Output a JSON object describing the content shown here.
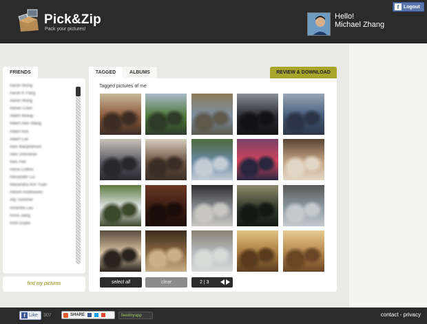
{
  "header": {
    "logo_title": "Pick&Zip",
    "logo_tagline": "Pack your pictures!",
    "greeting": "Hello!",
    "user_name": "Michael Zhang",
    "logout_label": "Logout"
  },
  "friends": {
    "tab_label": "FRIENDS",
    "items": [
      "Aaron Wong",
      "Aaron K Pang",
      "Aaron Wang",
      "Adrian Chen",
      "Albert Mckay",
      "Albert Alex Wang",
      "Albert Kim",
      "Albert Luk",
      "Alex Macpherson",
      "Alex Ostrowski",
      "Alex Pan",
      "Alexa Collins",
      "Alexander Liu",
      "Alexandra Ann Yuan",
      "Allison Andreasen",
      "Ally Sommer",
      "Amanda Lau",
      "Anna Jiang",
      "Amit Gupta"
    ],
    "find_label": "find my pictures"
  },
  "main": {
    "tabs": [
      {
        "label": "TAGGED",
        "active": true
      },
      {
        "label": "ALBUMS",
        "active": false
      }
    ],
    "review_label": "REVIEW & DOWNLOAD",
    "section_title": "Tagged pictures of me",
    "select_all_label": "select all",
    "clear_label": "clear",
    "pager_label": "2 | 3",
    "photos": [
      {
        "name": "photo-gym-group",
        "colors": [
          "#8a5a3a",
          "#c9b79a",
          "#3d2e25"
        ]
      },
      {
        "name": "photo-lawn-group",
        "colors": [
          "#4f7a3a",
          "#a8b9c8",
          "#2d3b28"
        ]
      },
      {
        "name": "photo-field-crowd",
        "colors": [
          "#7d8fa4",
          "#8c7b5a",
          "#5d5a4c"
        ]
      },
      {
        "name": "photo-silhouette-jump",
        "colors": [
          "#2a2a30",
          "#8a8e96",
          "#121214"
        ]
      },
      {
        "name": "photo-big-group",
        "colors": [
          "#445c7a",
          "#9aa6b5",
          "#2c3548"
        ]
      },
      {
        "name": "photo-indoor-group",
        "colors": [
          "#5c5c64",
          "#c8c2b8",
          "#28282c"
        ]
      },
      {
        "name": "photo-room-cake",
        "colors": [
          "#6b5340",
          "#d8cfc0",
          "#3a2e26"
        ]
      },
      {
        "name": "photo-street-group",
        "colors": [
          "#6a8aa8",
          "#4e6a3c",
          "#c3ccd4"
        ]
      },
      {
        "name": "photo-sunset-city",
        "colors": [
          "#d0435a",
          "#7c4266",
          "#2a2640"
        ]
      },
      {
        "name": "photo-selfie-group",
        "colors": [
          "#c4a686",
          "#5a4434",
          "#e2d6c4"
        ]
      },
      {
        "name": "photo-soccer-field",
        "colors": [
          "#e2e6e8",
          "#5c7a3e",
          "#3c4a2c"
        ]
      },
      {
        "name": "photo-dark-blur",
        "colors": [
          "#3a1c12",
          "#6a3824",
          "#1a0c08"
        ]
      },
      {
        "name": "photo-standing-group",
        "colors": [
          "#8a8e92",
          "#2e2a2c",
          "#c8c6c2"
        ]
      },
      {
        "name": "photo-outdoor-night",
        "colors": [
          "#33392c",
          "#8c8a6a",
          "#141a12"
        ]
      },
      {
        "name": "photo-pier-portrait",
        "colors": [
          "#8c9aa2",
          "#5a5a56",
          "#c4cacc"
        ]
      },
      {
        "name": "photo-beach-sunset",
        "colors": [
          "#d9c4a6",
          "#5a4d3e",
          "#2a241e"
        ]
      },
      {
        "name": "photo-dinner-table",
        "colors": [
          "#8a6a44",
          "#3c2c1e",
          "#c8b08a"
        ]
      },
      {
        "name": "photo-beach-kite",
        "colors": [
          "#b6bcc0",
          "#8c8274",
          "#d8dad8"
        ]
      },
      {
        "name": "photo-restaurant-group",
        "colors": [
          "#a67a3c",
          "#e2c286",
          "#5a3c1e"
        ]
      },
      {
        "name": "photo-restaurant-meal",
        "colors": [
          "#b2844a",
          "#e8cc94",
          "#6a4626"
        ]
      }
    ]
  },
  "footer": {
    "like_label": "Like",
    "like_count": "307",
    "share_label": "SHARE",
    "feed_label": "feedmyapp",
    "links_label": "contact - privacy"
  }
}
